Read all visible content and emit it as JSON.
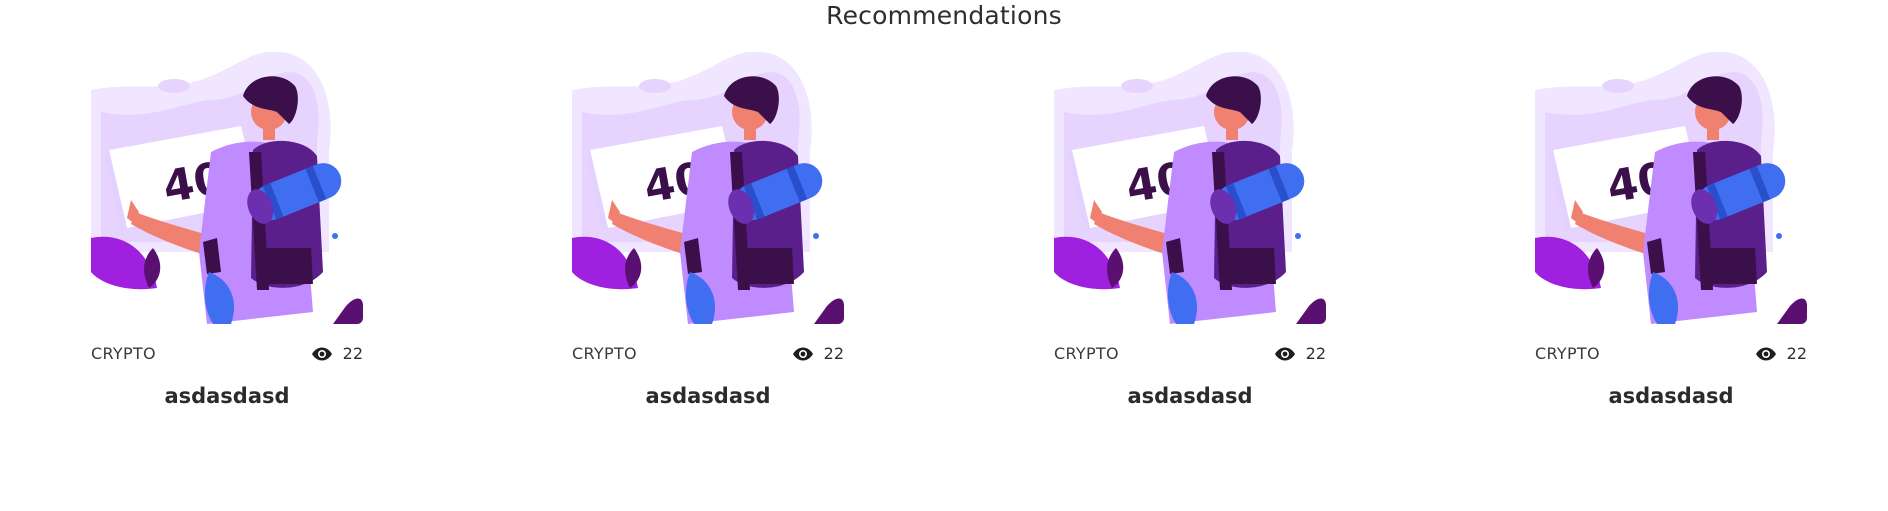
{
  "recommendations": {
    "title": "Recommendations",
    "cards": [
      {
        "image_alt": "404 traveler illustration",
        "category": "CRYPTO",
        "views": "22",
        "title": "asdasdasd"
      },
      {
        "image_alt": "404 traveler illustration",
        "category": "CRYPTO",
        "views": "22",
        "title": "asdasdasd"
      },
      {
        "image_alt": "404 traveler illustration",
        "category": "CRYPTO",
        "views": "22",
        "title": "asdasdasd"
      },
      {
        "image_alt": "404 traveler illustration",
        "category": "CRYPTO",
        "views": "22",
        "title": "asdasdasd"
      }
    ],
    "illustration_text": "404"
  },
  "colors": {
    "background": "#ffffff",
    "text_primary": "#2b2b2b",
    "illustration_purple": "#c08bff",
    "illustration_dark": "#3a0f4a",
    "illustration_blue": "#3f6ff0",
    "illustration_skin": "#f08070"
  },
  "icons": {
    "views": "eye-icon"
  }
}
